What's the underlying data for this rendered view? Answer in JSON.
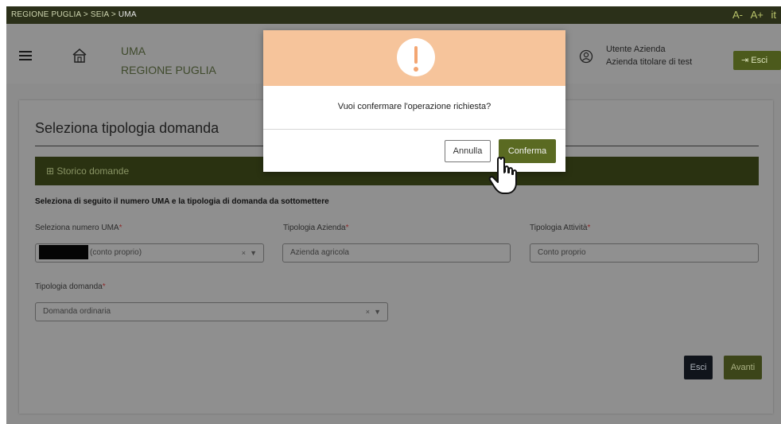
{
  "breadcrumb": {
    "items": [
      "REGIONE PUGLIA",
      "SEIA",
      "UMA"
    ],
    "separator": ">"
  },
  "language": {
    "decrease": "A-",
    "increase": "A+",
    "lang": "it"
  },
  "header": {
    "app_name": "UMA",
    "region": "REGIONE PUGLIA",
    "user_name": "Utente Azienda",
    "user_company": "Azienda titolare di test",
    "logout_label": "Esci"
  },
  "page": {
    "title": "Seleziona tipologia domanda",
    "storico_label": "Storico domande",
    "instructions": "Seleziona di seguito il numero UMA e la tipologia di domanda da sottomettere"
  },
  "form": {
    "uma": {
      "label": "Seleziona numero UMA",
      "value": "(conto proprio)",
      "clear": "×",
      "caret": "▼"
    },
    "tipologia_azienda": {
      "label": "Tipologia Azienda",
      "value": "Azienda agricola"
    },
    "tipologia_attivita": {
      "label": "Tipologia Attività",
      "value": "Conto proprio"
    },
    "tipologia_domanda": {
      "label": "Tipologia domanda",
      "value": "Domanda ordinaria",
      "clear": "×",
      "caret": "▼"
    },
    "required_mark": "*"
  },
  "actions": {
    "esci": "Esci",
    "avanti": "Avanti"
  },
  "modal": {
    "message": "Vuoi confermare l'operazione richiesta?",
    "cancel": "Annulla",
    "confirm": "Conferma"
  },
  "colors": {
    "topbar": "#2b3019",
    "accent": "#5a6a22",
    "modal_header": "#f6c49b",
    "required": "#8e2b2b"
  }
}
